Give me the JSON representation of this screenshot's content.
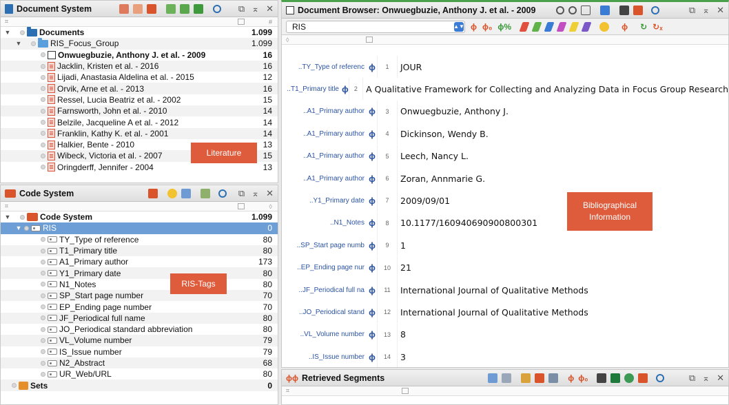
{
  "document_system": {
    "title": "Document System",
    "header_right": "#",
    "items": [
      {
        "label": "Documents",
        "count": "1.099",
        "level": 0,
        "type": "root"
      },
      {
        "label": "RIS_Focus_Group",
        "count": "1.099",
        "level": 1,
        "type": "group"
      },
      {
        "label": "Onwuegbuzie, Anthony J. et al. - 2009",
        "count": "16",
        "level": 2,
        "type": "active"
      },
      {
        "label": "Jacklin, Kristen et al. - 2016",
        "count": "16",
        "level": 2,
        "type": "doc"
      },
      {
        "label": "Lijadi, Anastasia Aldelina et al. - 2015",
        "count": "12",
        "level": 2,
        "type": "doc"
      },
      {
        "label": "Orvik, Arne et al. - 2013",
        "count": "16",
        "level": 2,
        "type": "doc"
      },
      {
        "label": "Ressel, Lucia Beatriz et al. - 2002",
        "count": "15",
        "level": 2,
        "type": "doc"
      },
      {
        "label": "Farnsworth, John et al. - 2010",
        "count": "14",
        "level": 2,
        "type": "doc"
      },
      {
        "label": "Belzile, Jacqueline A et al. - 2012",
        "count": "14",
        "level": 2,
        "type": "doc"
      },
      {
        "label": "Franklin, Kathy K. et al. - 2001",
        "count": "14",
        "level": 2,
        "type": "doc"
      },
      {
        "label": "Halkier, Bente - 2010",
        "count": "13",
        "level": 2,
        "type": "doc"
      },
      {
        "label": "Wibeck, Victoria et al. - 2007",
        "count": "15",
        "level": 2,
        "type": "doc"
      },
      {
        "label": "Oringderff, Jennifer - 2004",
        "count": "13",
        "level": 2,
        "type": "doc"
      }
    ],
    "annotation": "Literature"
  },
  "code_system": {
    "title": "Code System",
    "items": [
      {
        "label": "Code System",
        "count": "1.099",
        "level": 0,
        "type": "root"
      },
      {
        "label": "RIS",
        "count": "0",
        "level": 1,
        "type": "selected"
      },
      {
        "label": "TY_Type of reference",
        "count": "80",
        "level": 2,
        "type": "code"
      },
      {
        "label": "T1_Primary title",
        "count": "80",
        "level": 2,
        "type": "code"
      },
      {
        "label": "A1_Primary author",
        "count": "173",
        "level": 2,
        "type": "code"
      },
      {
        "label": "Y1_Primary date",
        "count": "80",
        "level": 2,
        "type": "code"
      },
      {
        "label": "N1_Notes",
        "count": "80",
        "level": 2,
        "type": "code"
      },
      {
        "label": "SP_Start page number",
        "count": "70",
        "level": 2,
        "type": "code"
      },
      {
        "label": "EP_Ending page number",
        "count": "70",
        "level": 2,
        "type": "code"
      },
      {
        "label": "JF_Periodical full name",
        "count": "80",
        "level": 2,
        "type": "code"
      },
      {
        "label": "JO_Periodical standard abbreviation",
        "count": "80",
        "level": 2,
        "type": "code"
      },
      {
        "label": "VL_Volume number",
        "count": "79",
        "level": 2,
        "type": "code"
      },
      {
        "label": "IS_Issue number",
        "count": "79",
        "level": 2,
        "type": "code"
      },
      {
        "label": "N2_Abstract",
        "count": "68",
        "level": 2,
        "type": "code"
      },
      {
        "label": "UR_Web/URL",
        "count": "80",
        "level": 2,
        "type": "code"
      },
      {
        "label": "Sets",
        "count": "0",
        "level": 0,
        "type": "sets"
      }
    ],
    "annotation": "RIS-Tags"
  },
  "document_browser": {
    "title": "Document Browser: Onwuegbuzie, Anthony J. et al. - 2009",
    "select_value": "RIS",
    "rows": [
      {
        "field": "..TY_Type of referenc",
        "num": "1",
        "value": "JOUR"
      },
      {
        "field": "..T1_Primary title",
        "num": "2",
        "value": "A Qualitative Framework for Collecting and Analyzing Data in Focus Group Research"
      },
      {
        "field": "..A1_Primary author",
        "num": "3",
        "value": "Onwuegbuzie, Anthony J."
      },
      {
        "field": "..A1_Primary author",
        "num": "4",
        "value": "Dickinson, Wendy B."
      },
      {
        "field": "..A1_Primary author",
        "num": "5",
        "value": "Leech, Nancy L."
      },
      {
        "field": "..A1_Primary author",
        "num": "6",
        "value": "Zoran, Annmarie G."
      },
      {
        "field": "..Y1_Primary date",
        "num": "7",
        "value": "2009/09/01"
      },
      {
        "field": "..N1_Notes",
        "num": "8",
        "value": "10.1177/160940690900800301"
      },
      {
        "field": "..SP_Start page numb",
        "num": "9",
        "value": "1"
      },
      {
        "field": "..EP_Ending page nur",
        "num": "10",
        "value": "21"
      },
      {
        "field": "..JF_Periodical full na",
        "num": "11",
        "value": "International Journal of Qualitative Methods"
      },
      {
        "field": "..JO_Periodical stand",
        "num": "12",
        "value": "International Journal of Qualitative Methods"
      },
      {
        "field": "..VL_Volume number",
        "num": "13",
        "value": "8"
      },
      {
        "field": "..IS_Issue number",
        "num": "14",
        "value": "3"
      }
    ],
    "annotation_line1": "Bibliographical",
    "annotation_line2": "Information"
  },
  "retrieved_segments": {
    "title": "Retrieved Segments"
  },
  "colors": {
    "selection": "#6d9fd6",
    "annotation": "#de5b3c",
    "field_blue": "#2b53a3"
  }
}
